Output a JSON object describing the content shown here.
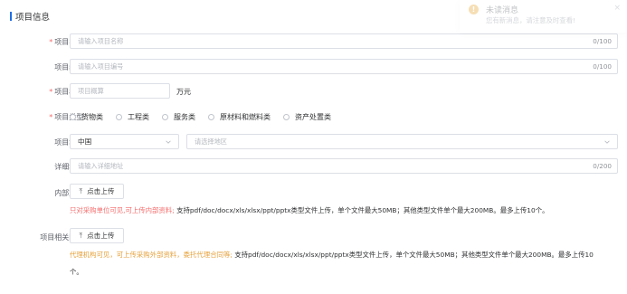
{
  "section": {
    "title": "项目信息"
  },
  "form": {
    "name": {
      "label": "项目名称:",
      "placeholder": "请输入项目名称",
      "counter": "0/100",
      "required": "*"
    },
    "code": {
      "label": "项目编号:",
      "placeholder": "请输入项目编号",
      "counter": "0/100"
    },
    "budget": {
      "label": "项目概算:",
      "placeholder": "项目概算",
      "unit": "万元",
      "required": "*"
    },
    "type": {
      "label": "项目类型:",
      "required": "*",
      "options": [
        "货物类",
        "工程类",
        "服务类",
        "原材料和燃料类",
        "资产处置类"
      ]
    },
    "location": {
      "label": "项目地点:",
      "country": "中国",
      "region_placeholder": "请选择地区"
    },
    "address": {
      "label": "详细地址:",
      "placeholder": "请输入详细地址",
      "counter": "0/200"
    },
    "internal_files": {
      "label": "内部文件:",
      "button": "点击上传",
      "hint_red": "只对采购单位可见,可上传内部资料;",
      "hint_rest": "支持pdf/doc/docx/xls/xlsx/ppt/pptx类型文件上传，单个文件最大50MB；其他类型文件单个最大200MB。最多上传10个。"
    },
    "attachments": {
      "label": "项目相关附件:",
      "button": "点击上传",
      "hint_orange": "代理机构可见，可上传采购外部资料，委托代理合同等;",
      "hint_rest_line1": "支持pdf/doc/docx/xls/xlsx/ppt/pptx类型文件上传，单个文件最大50MB；其他类型文件单个最大200MB。最多上传10",
      "hint_rest_line2": "个。"
    }
  },
  "notification": {
    "title": "未读消息",
    "message": "您有新消息，请注意及时查看!",
    "close": "×",
    "icon": "!"
  },
  "icons": {
    "upload": "⤒"
  }
}
